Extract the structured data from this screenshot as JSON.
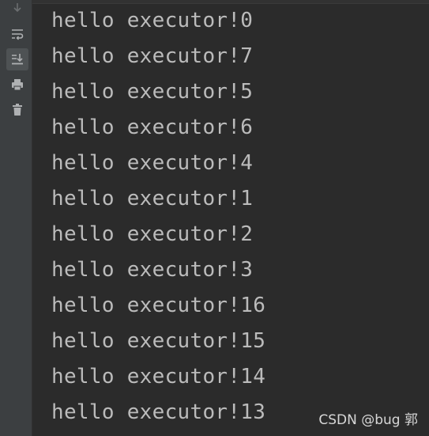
{
  "toolbar": {
    "buttons": [
      {
        "icon": "scroll-down-arrow-icon"
      },
      {
        "icon": "soft-wrap-icon"
      },
      {
        "icon": "scroll-to-end-icon",
        "active": true
      },
      {
        "icon": "print-icon"
      },
      {
        "icon": "trash-icon"
      }
    ]
  },
  "console": {
    "lines": [
      "hello executor!0",
      "hello executor!7",
      "hello executor!5",
      "hello executor!6",
      "hello executor!4",
      "hello executor!1",
      "hello executor!2",
      "hello executor!3",
      "hello executor!16",
      "hello executor!15",
      "hello executor!14",
      "hello executor!13"
    ]
  },
  "watermark": "CSDN @bug 郭",
  "colors": {
    "background": "#2b2b2b",
    "toolbar": "#3c3f41",
    "text": "#bbbbbb",
    "icon": "#afb1b3"
  }
}
